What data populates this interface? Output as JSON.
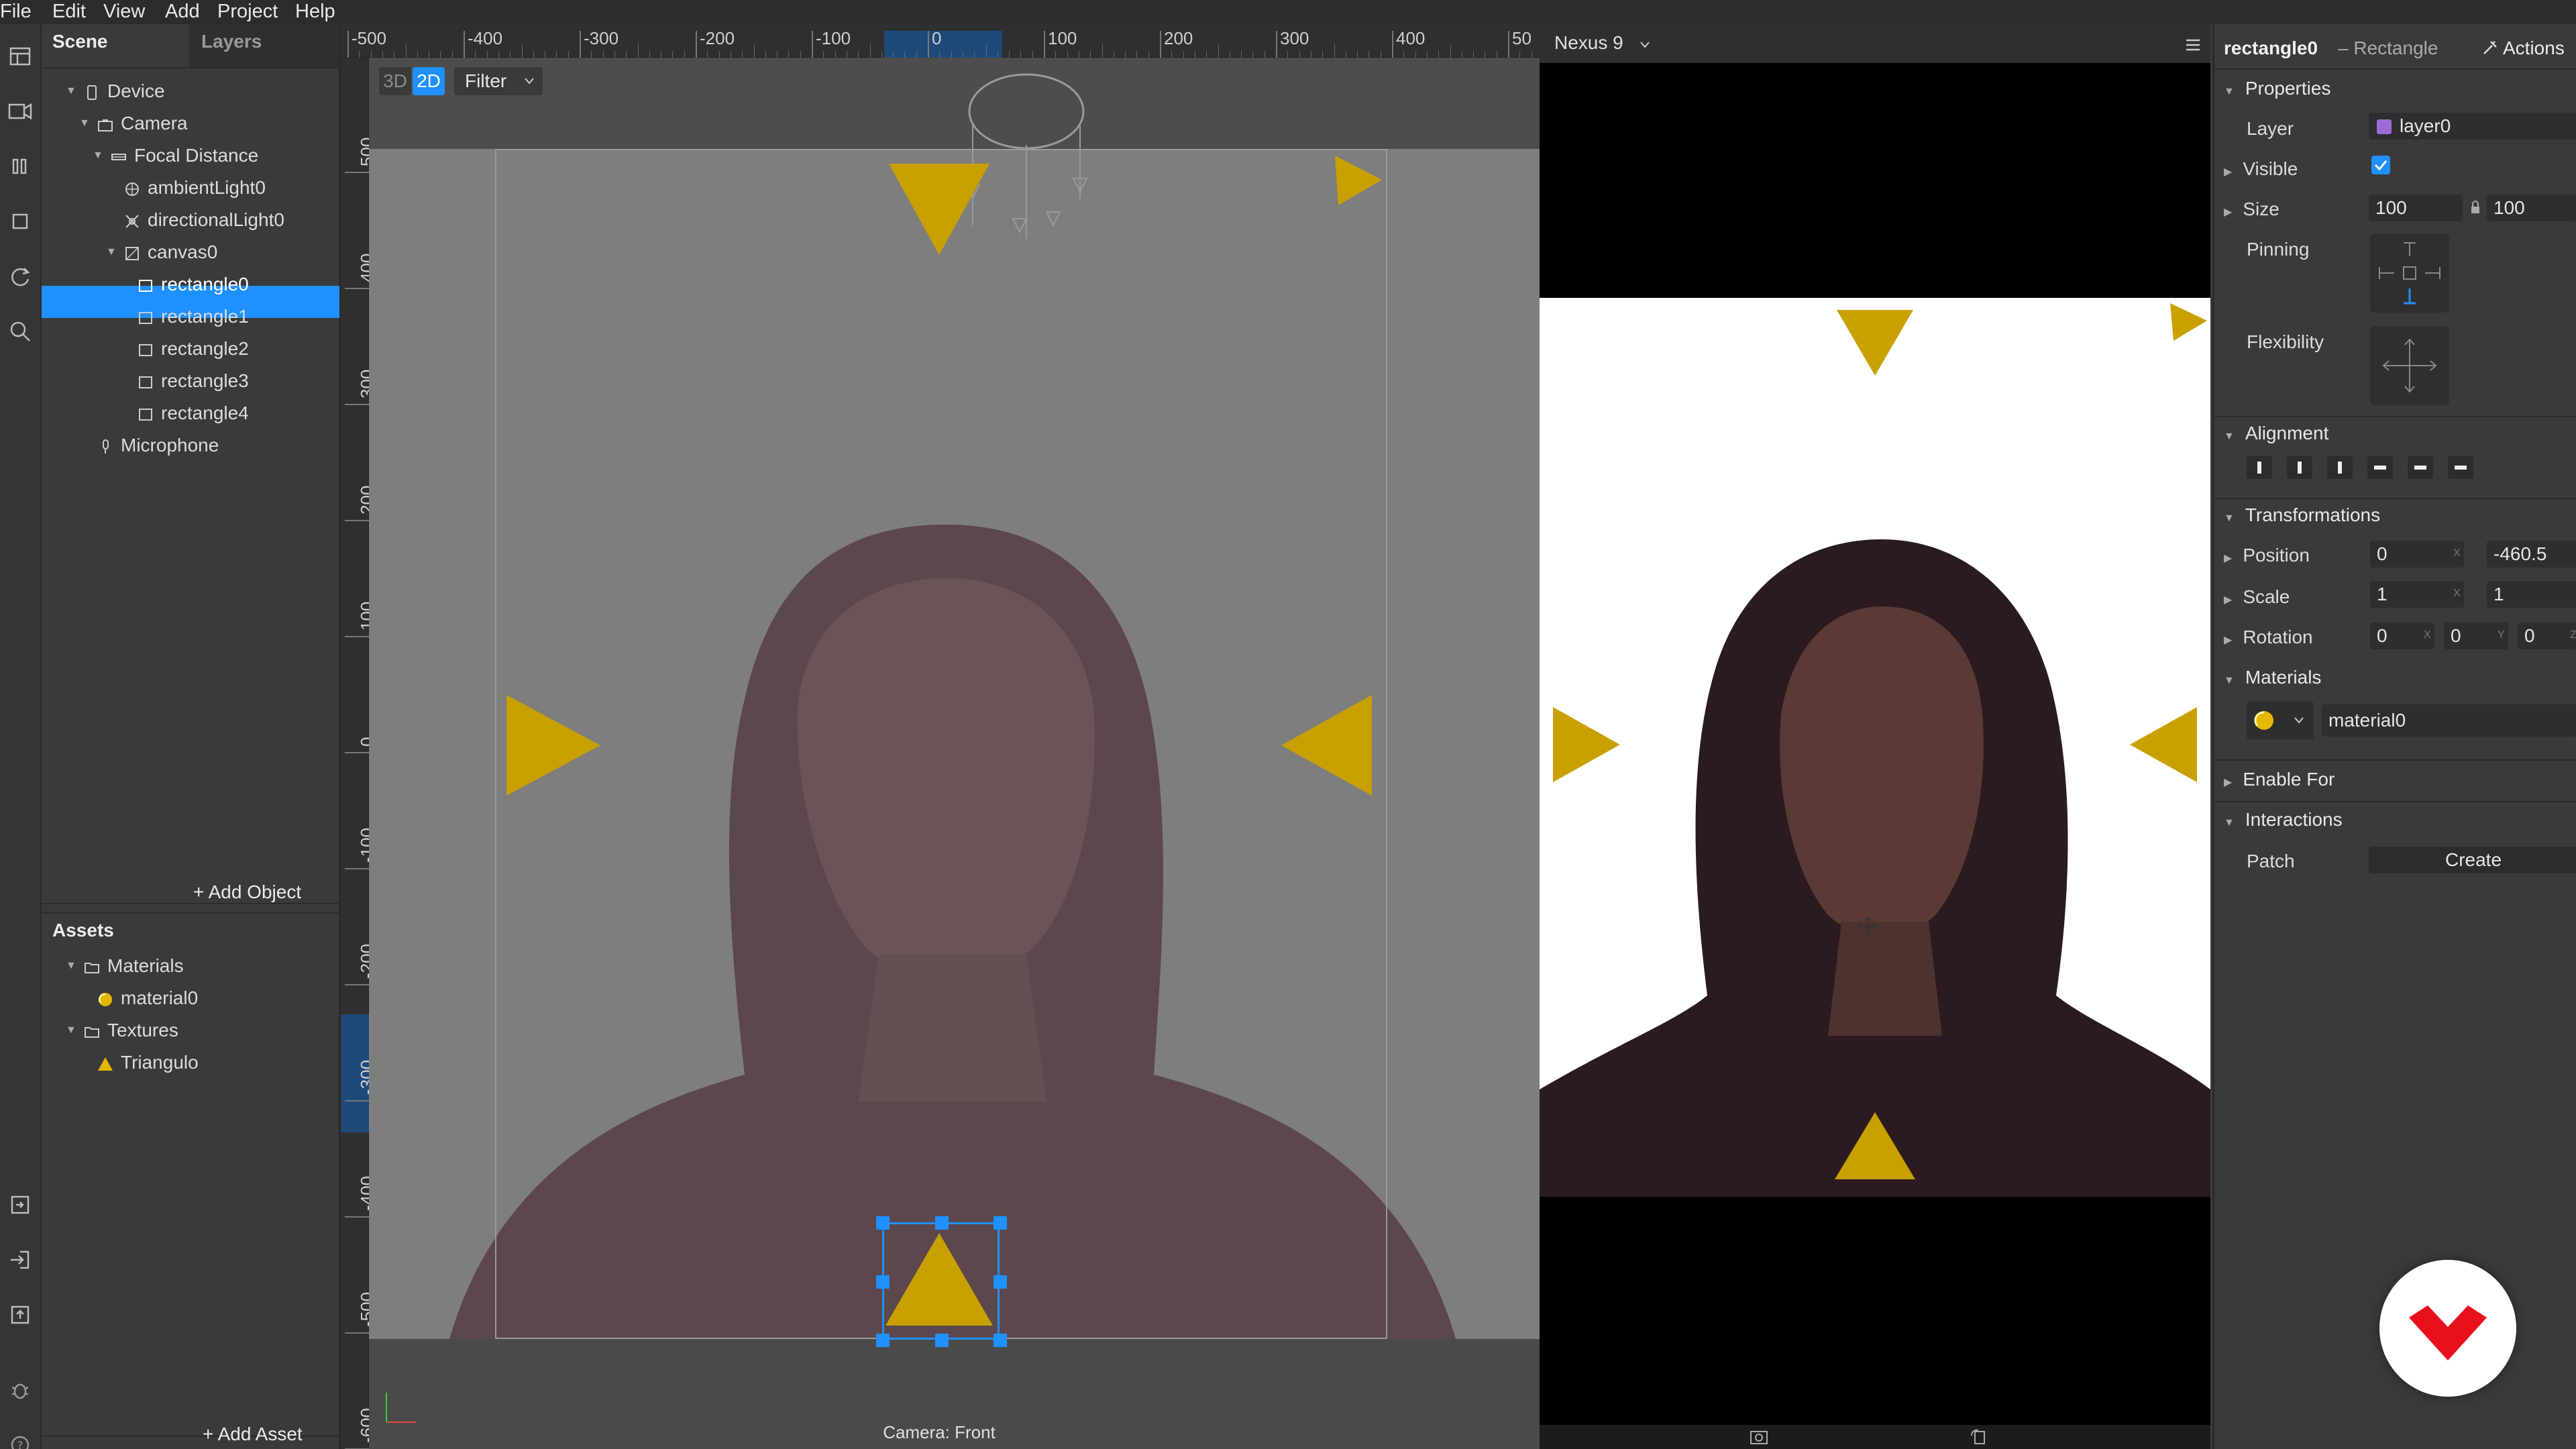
{
  "menu": [
    "File",
    "Edit",
    "View",
    "Add",
    "Project",
    "Help"
  ],
  "scene_panel": {
    "tabs": [
      "Scene",
      "Layers"
    ],
    "tree": [
      {
        "label": "Device",
        "icon": "phone-icon"
      },
      {
        "label": "Camera",
        "icon": "camera-icon"
      },
      {
        "label": "Focal Distance",
        "icon": "focal-distance-icon"
      },
      {
        "label": "ambientLight0",
        "icon": "ambient-light-icon"
      },
      {
        "label": "directionalLight0",
        "icon": "directional-light-icon"
      },
      {
        "label": "canvas0",
        "icon": "canvas-icon"
      },
      {
        "label": "rectangle0",
        "icon": "rectangle-icon"
      },
      {
        "label": "rectangle1",
        "icon": "rectangle-icon"
      },
      {
        "label": "rectangle2",
        "icon": "rectangle-icon"
      },
      {
        "label": "rectangle3",
        "icon": "rectangle-icon"
      },
      {
        "label": "rectangle4",
        "icon": "rectangle-icon"
      },
      {
        "label": "Microphone",
        "icon": "microphone-icon"
      }
    ],
    "add_object": "+ Add Object",
    "assets_title": "Assets",
    "assets": [
      {
        "label": "Materials",
        "icon": "folder-icon"
      },
      {
        "label": "material0",
        "icon": "material-icon"
      },
      {
        "label": "Textures",
        "icon": "folder-icon"
      },
      {
        "label": "Triangulo",
        "icon": "triangle-texture-icon"
      }
    ],
    "add_asset": "+ Add Asset"
  },
  "viewport": {
    "mode_3d": "3D",
    "mode_2d": "2D",
    "filter": "Filter",
    "ruler_top": [
      "-500",
      "-400",
      "-300",
      "-200",
      "-100",
      "0",
      "100",
      "200",
      "300",
      "400",
      "50"
    ],
    "ruler_left": [
      "500",
      "400",
      "300",
      "200",
      "100",
      "0",
      "-100",
      "-200",
      "-300",
      "-400",
      "-500",
      "-600"
    ],
    "camera_label": "Camera: Front"
  },
  "simulator": {
    "device": "Nexus 9"
  },
  "inspector": {
    "object_name": "rectangle0",
    "object_type": "– Rectangle",
    "actions": "Actions",
    "properties_title": "Properties",
    "layer_label": "Layer",
    "layer_value": "layer0",
    "visible_label": "Visible",
    "visible_checked": true,
    "size_label": "Size",
    "size_w": "100",
    "size_h": "100",
    "pinning_label": "Pinning",
    "flexibility_label": "Flexibility",
    "alignment_title": "Alignment",
    "transformations_title": "Transformations",
    "position_label": "Position",
    "position_x": "0",
    "position_y": "-460.5",
    "scale_label": "Scale",
    "scale_x": "1",
    "scale_y": "1",
    "rotation_label": "Rotation",
    "rotation_x": "0",
    "rotation_y": "0",
    "rotation_z": "0",
    "axis_x": "X",
    "axis_y": "Y",
    "axis_z": "Z",
    "materials_title": "Materials",
    "material_value": "material0",
    "enable_for_title": "Enable For",
    "interactions_title": "Interactions",
    "patch_label": "Patch",
    "create_label": "Create"
  },
  "colors": {
    "accent": "#1e90ff",
    "triangle": "#c9a000",
    "layer_swatch": "#9b6cd6",
    "logo_red": "#e8101b"
  }
}
